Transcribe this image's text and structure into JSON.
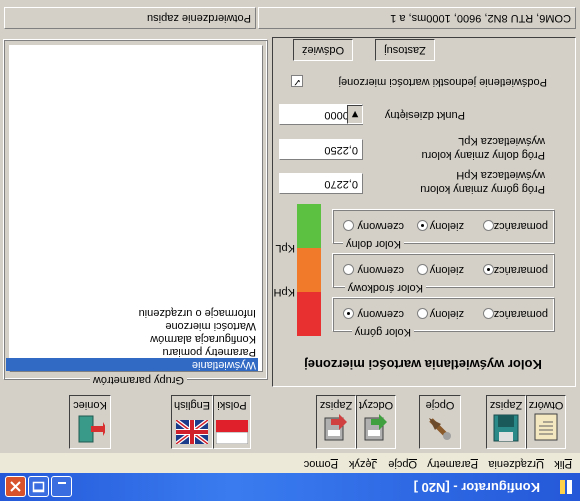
{
  "window": {
    "title": "Konfigurator - [N20 ]"
  },
  "menu": [
    "Plik",
    "Urządzenia",
    "Parametry",
    "Opcje",
    "Język",
    "Pomoc"
  ],
  "toolbar": {
    "otworz": "Otwórz",
    "zapisz": "Zapisz",
    "opcje": "Opcje",
    "odczyt": "Odczyt",
    "zapisz2": "Zapisz",
    "polski": "Polski",
    "english": "English",
    "koniec": "Koniec"
  },
  "parameters_group": {
    "title": "Grupy parametrów",
    "items": [
      "Wyświetlanie",
      "Parametry pomiaru",
      "Konfiguracja alarmów",
      "Wartości mierzone",
      "Informacje o urządzeniu"
    ],
    "selected": 0
  },
  "display_panel": {
    "title": "Kolor wyświetlania wartości mierzonej",
    "upper_color": {
      "title": "Kolor górny",
      "options": [
        "czerwony",
        "zielony",
        "pomarańcz"
      ],
      "selected": 0
    },
    "middle_color": {
      "title": "Kolor środkowy",
      "options": [
        "czerwony",
        "zielony",
        "pomarańcz"
      ],
      "selected": 2
    },
    "lower_color": {
      "title": "Kolor dolny",
      "options": [
        "czerwony",
        "zielony",
        "pomarańcz"
      ],
      "selected": 1
    },
    "kph_label": "KpH",
    "kpl_label": "KpL",
    "bar_colors": {
      "top": "#e83030",
      "middle": "#f07a2a",
      "bottom": "#5cc040"
    },
    "upper_threshold": {
      "label": "Próg górny zmiany koloru wyświetlacza KpH",
      "value": "0,2270"
    },
    "lower_threshold": {
      "label": "Próg dolny zmiany koloru wyświetlacza KpL",
      "value": "0,2250"
    },
    "decimal_point": {
      "label": "Punkt dziesiętny",
      "value": "0.0000"
    },
    "backlight": {
      "label": "Podświetlenie jednostki wartości mierzonej",
      "checked": true
    },
    "apply_button": "Zastosuj",
    "refresh_button": "Odśwież"
  },
  "status": {
    "connection": "COM6, RTU 8N2, 9600, 1000ms, a 1",
    "message": "Potwierdzenie zapisu"
  }
}
